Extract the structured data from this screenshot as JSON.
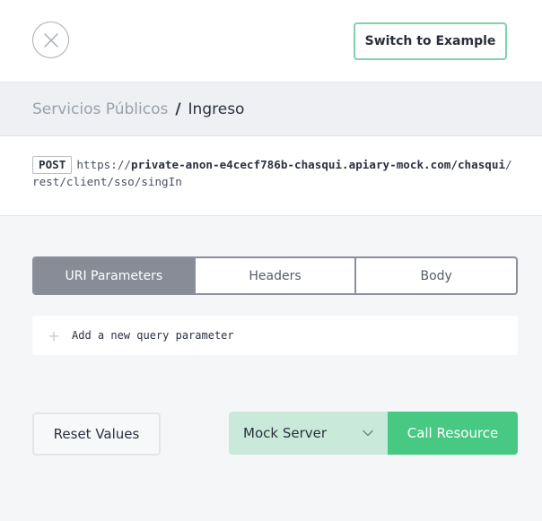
{
  "header": {
    "close_icon": "close-icon",
    "switch_label": "Switch to Example"
  },
  "title": {
    "section": "Servicios Públicos",
    "separator": "/",
    "action": "Ingreso"
  },
  "request": {
    "method": "POST",
    "url_prefix": "https://",
    "url_host": "private-anon-e4cecf786b-chasqui.apiary-mock.com/chasqui",
    "url_path": "/rest/client/sso/singIn"
  },
  "tabs": [
    {
      "label": "URI Parameters",
      "active": true
    },
    {
      "label": "Headers",
      "active": false
    },
    {
      "label": "Body",
      "active": false
    }
  ],
  "params": {
    "add_icon": "plus-icon",
    "add_label": "Add a new query parameter"
  },
  "actions": {
    "reset_label": "Reset Values",
    "environment_selected": "Mock Server",
    "environment_icon": "chevron-down-icon",
    "call_label": "Call Resource"
  },
  "colors": {
    "accent_green": "#47c984",
    "accent_green_light": "#c9eadb",
    "tab_active_bg": "#878c96",
    "switch_border": "#7fd3ab"
  }
}
